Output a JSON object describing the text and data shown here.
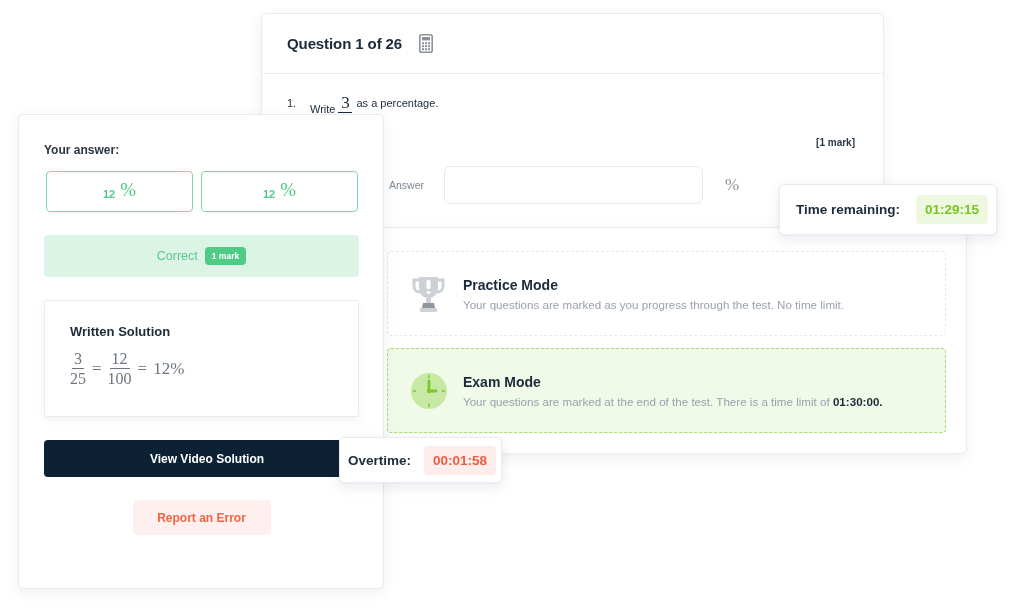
{
  "question_card": {
    "title": "Question 1 of 26",
    "number": "1.",
    "prompt": {
      "before": "Write",
      "numerator": "3",
      "after": "as a percentage."
    },
    "marks": "[1 mark]",
    "answer_label": "Answer",
    "unit": "%"
  },
  "answer_card": {
    "heading": "Your answer:",
    "answers": [
      {
        "value": "12",
        "unit": "%",
        "correct": true
      },
      {
        "value": "12",
        "unit": "%",
        "correct": true
      }
    ],
    "result": {
      "label": "Correct",
      "badge": "1 mark",
      "correct": true
    },
    "solution": {
      "title": "Written Solution",
      "math": [
        {
          "kind": "fraction",
          "numerator": "3",
          "denominator": "25"
        },
        {
          "kind": "operator",
          "text": "="
        },
        {
          "kind": "fraction",
          "numerator": "12",
          "denominator": "100"
        },
        {
          "kind": "operator",
          "text": "="
        },
        {
          "kind": "text",
          "text": "12%"
        }
      ]
    },
    "buttons": [
      {
        "label": "View Video Solution",
        "kind": "primary"
      },
      {
        "label": "Report an Error",
        "kind": "report"
      }
    ]
  },
  "mode_card": {
    "modes": [
      {
        "kind": "practice",
        "title": "Practice Mode",
        "description": "Your questions are marked as you progress through the test. No time limit.",
        "selected": false
      },
      {
        "kind": "exam",
        "title": "Exam Mode",
        "description": "Your questions are marked at the end of the test. There is a time limit of **01:30:00.**",
        "selected": true
      }
    ]
  },
  "timer": {
    "label": "Time remaining:",
    "value": "01:29:15"
  },
  "overtime": {
    "label": "Overtime:",
    "value": "00:01:58"
  }
}
